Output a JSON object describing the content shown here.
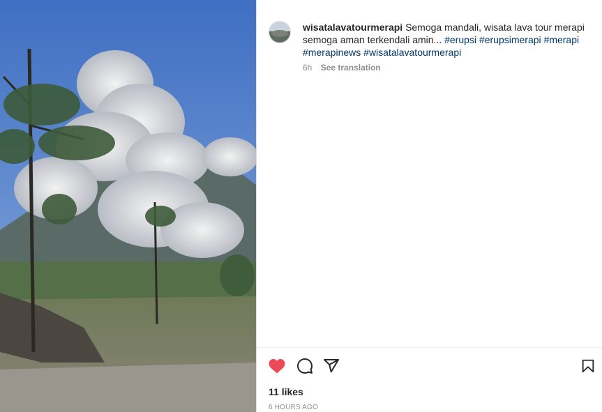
{
  "post": {
    "username": "wisatalavatourmerapi",
    "caption_text": "Semoga mandali, wisata lava tour merapi semoga aman terkendali amin...",
    "hashtags": [
      "#erupsi",
      "#erupsimerapi",
      "#merapi",
      "#merapinews",
      "#wisatalavatourmerapi"
    ],
    "age": "6h",
    "see_translation": "See translation",
    "likes": "11 likes",
    "timestamp": "6 HOURS AGO"
  },
  "icons": {
    "like": "heart-icon",
    "comment": "comment-icon",
    "share": "paper-plane-icon",
    "save": "bookmark-icon"
  },
  "colors": {
    "like_red": "#ed4956",
    "hashtag_blue": "#00376b",
    "muted": "#8e8e8e",
    "text": "#262626"
  }
}
